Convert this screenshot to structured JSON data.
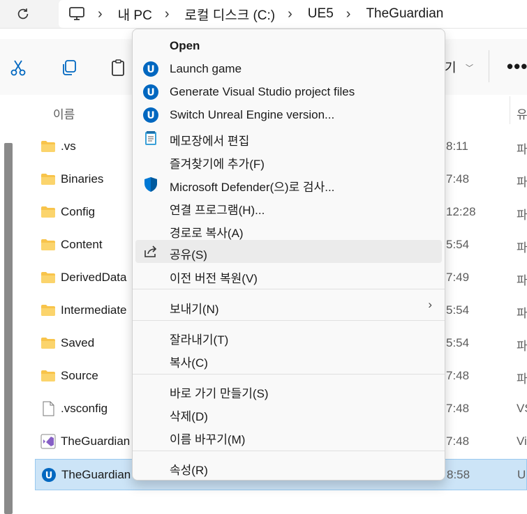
{
  "address": {
    "breadcrumbs": [
      "내 PC",
      "로컬 디스크 (C:)",
      "UE5",
      "TheGuardian"
    ]
  },
  "toolbar": {
    "sort_label_fragment": "기",
    "more_label": "•••"
  },
  "filelist": {
    "col_name": "이름",
    "col_type_fragment": "유",
    "rows": [
      {
        "name": ".vs",
        "time": "8:11",
        "type": "파",
        "icon": "folder-icon"
      },
      {
        "name": "Binaries",
        "time": "7:48",
        "type": "파",
        "icon": "folder-icon"
      },
      {
        "name": "Config",
        "time": "12:28",
        "type": "파",
        "icon": "folder-icon"
      },
      {
        "name": "Content",
        "time": "5:54",
        "type": "파",
        "icon": "folder-icon"
      },
      {
        "name": "DerivedData",
        "time": "7:49",
        "type": "파",
        "icon": "folder-icon"
      },
      {
        "name": "Intermediate",
        "time": "5:54",
        "type": "파",
        "icon": "folder-icon"
      },
      {
        "name": "Saved",
        "time": "5:54",
        "type": "파",
        "icon": "folder-icon"
      },
      {
        "name": "Source",
        "time": "7:48",
        "type": "파",
        "icon": "folder-icon"
      },
      {
        "name": ".vsconfig",
        "time": "7:48",
        "type": "VS",
        "icon": "file-icon"
      },
      {
        "name": "TheGuardian",
        "time": "7:48",
        "type": "Vi",
        "icon": "visual-studio-icon"
      },
      {
        "name": "TheGuardian",
        "time": "8:58",
        "type": "U",
        "icon": "unreal-engine-icon"
      }
    ]
  },
  "menu": {
    "open": "Open",
    "launch_game": "Launch game",
    "generate_vs": "Generate Visual Studio project files",
    "switch_ue": "Switch Unreal Engine version...",
    "edit_notepad": "메모장에서 편집",
    "add_favorites": "즐겨찾기에 추가(F)",
    "defender_scan": "Microsoft Defender(으)로 검사...",
    "open_with": "연결 프로그램(H)...",
    "copy_path": "경로로 복사(A)",
    "share": "공유(S)",
    "restore_prev": "이전 버전 복원(V)",
    "send_to": "보내기(N)",
    "cut": "잘라내기(T)",
    "copy": "복사(C)",
    "create_shortcut": "바로 가기 만들기(S)",
    "delete": "삭제(D)",
    "rename": "이름 바꾸기(M)",
    "properties": "속성(R)",
    "submenu_arrow": "›"
  },
  "colors": {
    "accent": "#0067c0",
    "selection": "#cce4f7",
    "folder": "#f8c44b"
  }
}
